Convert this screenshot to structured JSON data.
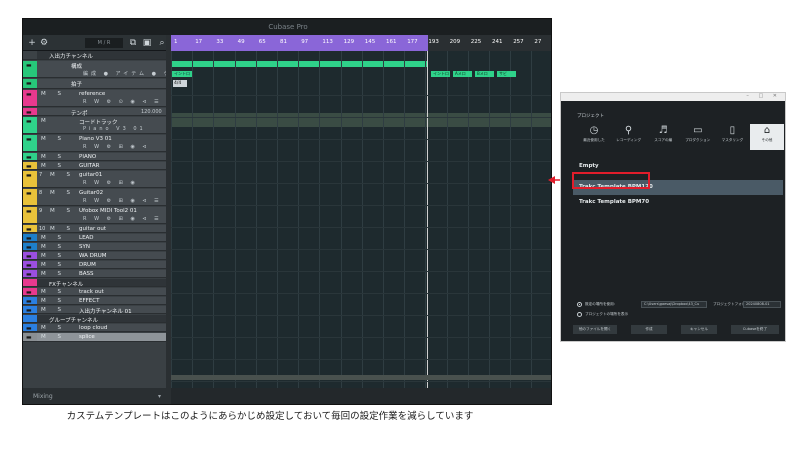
{
  "daw": {
    "window_title": "Cubase Pro",
    "toolbar": {
      "add_icon": "+",
      "zoom_label": "M / R",
      "search_icon": "search-icon"
    },
    "tracks": [
      {
        "name": "入出力チャンネル",
        "type": "folder-header",
        "color": "#3c4246"
      },
      {
        "name": "構成",
        "sub": "編成  ●  アイテム ●  ゲート ●",
        "color": "#27c77a",
        "type": "arranger"
      },
      {
        "name": "拍子",
        "type": "signature",
        "color": "#27c77a"
      },
      {
        "name": "reference",
        "sub": "R W ⚙ ⊙ ◉ ⊲ ☰",
        "ms": "M S",
        "color": "#e8398e"
      },
      {
        "name": "テンポ",
        "value": "120.000",
        "color": "#e8398e"
      },
      {
        "name": "コードトラック",
        "sub": "Piano V3 01",
        "ms": "M",
        "color": "#2fd28a"
      },
      {
        "name": "Piano V3 01",
        "sub": "R W ⚙ ⊞ ◉ ⊲",
        "ms": "M S",
        "color": "#2fd28a"
      },
      {
        "name": "PIANO",
        "ms": "M S",
        "color": "#2fd28a"
      },
      {
        "name": "GUITAR",
        "ms": "M S",
        "color": "#e9c23a"
      },
      {
        "name": "guitar01",
        "sub": "R W ⚙ ⊞ ◉",
        "ms": "M S",
        "num": "7",
        "color": "#e9c23a"
      },
      {
        "name": "Guitar02",
        "sub": "R W ⚙ ⊞ ◉ ⊲ ☰",
        "ms": "M S",
        "num": "8",
        "color": "#e9c23a"
      },
      {
        "name": "Ufobox MIDI Tool2 01",
        "sub": "R W ⚙ ⊞ ◉ ⊲ ☰",
        "ms": "M S",
        "num": "9",
        "color": "#e9c23a"
      },
      {
        "name": "guitar out",
        "ms": "M S",
        "num": "10",
        "color": "#e9c23a"
      },
      {
        "name": "LEAD",
        "ms": "M S",
        "color": "#1e7fc9"
      },
      {
        "name": "SYN",
        "ms": "M S",
        "color": "#1e7fc9"
      },
      {
        "name": "WA DRUM",
        "ms": "M S",
        "color": "#9b4fe0"
      },
      {
        "name": "DRUM",
        "ms": "M S",
        "color": "#9b4fe0"
      },
      {
        "name": "BASS",
        "ms": "M S",
        "color": "#9b4fe0"
      },
      {
        "name": "FXチャンネル",
        "type": "folder-header",
        "color": "#e8398e"
      },
      {
        "name": "track out",
        "ms": "M S",
        "color": "#e8398e"
      },
      {
        "name": "EFFECT",
        "ms": "M S",
        "color": "#2b7fe0"
      },
      {
        "name": "入出力チャンネル 01",
        "ms": "M S",
        "color": "#2b7fe0"
      },
      {
        "name": "グループチャンネル",
        "type": "folder-header",
        "color": "#2b7fe0"
      },
      {
        "name": "loop cloud",
        "ms": "M S",
        "color": "#2b7fe0"
      },
      {
        "name": "splice",
        "ms": "M S",
        "color": "#8a8f93",
        "selected": true
      }
    ],
    "footer": "Mixing",
    "ruler_ticks": [
      "1",
      "17",
      "33",
      "49",
      "65",
      "81",
      "97",
      "113",
      "129",
      "145",
      "161",
      "177",
      "193",
      "209",
      "225",
      "241",
      "257",
      "27"
    ],
    "markers": [
      "イントロ",
      "Aメロ",
      "Bメロ",
      "サビ"
    ],
    "signature": "4/4"
  },
  "hub": {
    "section_label": "プロジェクト",
    "categories": [
      {
        "label": "最近使用した",
        "icon": "clock-icon",
        "glyph": "◷"
      },
      {
        "label": "レコーディング",
        "icon": "microphone-icon",
        "glyph": "⚲"
      },
      {
        "label": "スコアの編",
        "icon": "score-icon",
        "glyph": "♬"
      },
      {
        "label": "プロダクション",
        "icon": "production-icon",
        "glyph": "▭"
      },
      {
        "label": "マスタリング",
        "icon": "mastering-icon",
        "glyph": "▯"
      },
      {
        "label": "その他",
        "icon": "tag-icon",
        "glyph": "⌂",
        "active": true
      }
    ],
    "templates": [
      {
        "name": "Empty"
      },
      {
        "name": "Trakc Template BPM120",
        "selected": true
      },
      {
        "name": "Trakc Template BPM70"
      }
    ],
    "location_default_label": "既定の場所を使用：",
    "location_path": "C:\\Users\\gaesaj\\Dropbox\\43_Cu",
    "folder_label": "プロジェクトフォルダ",
    "folder_value": "20240808-01",
    "prompt_location_label": "プロジェクトの場所を表示",
    "buttons": [
      "他のファイルを開く",
      "作成",
      "キャンセル",
      "Cubaseを終了"
    ]
  },
  "caption": "カステムテンプレートはこのようにあらかじめ設定しておいて毎回の設定作業を減らしています",
  "colors": {
    "highlight": "#e11d2b",
    "loop": "#8a66d8",
    "arranger": "#2fd28a"
  }
}
